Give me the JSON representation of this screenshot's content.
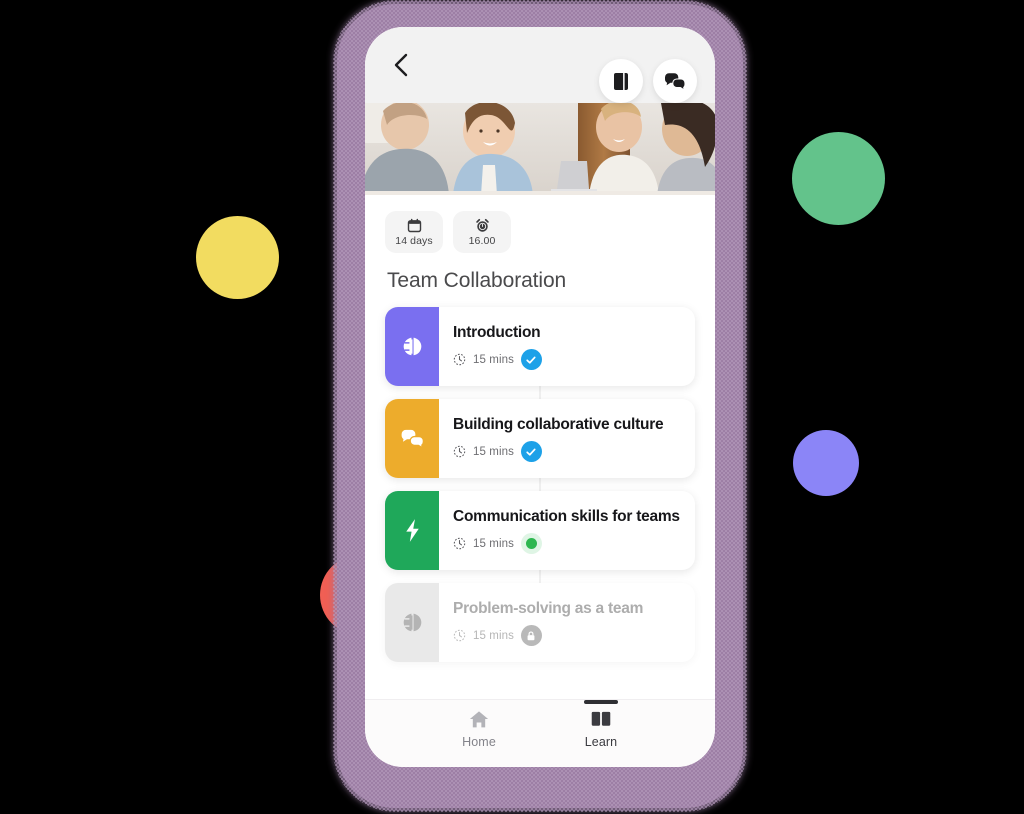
{
  "colors": {
    "deco_green": "#63c38b",
    "deco_yellow": "#f2dc60",
    "deco_purple": "#8b85f7",
    "deco_red": "#f05f54",
    "phone_frame": "#9d7fa5",
    "badge_check": "#1da1e8",
    "badge_dot": "#2eb750",
    "badge_lock": "#b9b9b9",
    "tile_intro": "#7a6ff0",
    "tile_culture": "#edac2c",
    "tile_communication": "#1fa85a",
    "tile_locked": "#e9e9e9"
  },
  "header": {
    "back_icon": "chevron-left-icon",
    "actions": [
      {
        "name": "book-button",
        "icon": "book-icon"
      },
      {
        "name": "chat-button",
        "icon": "chat-bubbles-icon"
      }
    ]
  },
  "hero": {
    "alt": "team collaborating at a table"
  },
  "chips": [
    {
      "icon": "calendar-icon",
      "label": "14 days"
    },
    {
      "icon": "alarm-clock-icon",
      "label": "16.00"
    }
  ],
  "main": {
    "title": "Team Collaboration",
    "lessons": [
      {
        "title": "Introduction",
        "duration": "15 mins",
        "duration_icon": "timer-icon",
        "tile_icon": "brain-icon",
        "tile_color": "#7a6ff0",
        "status": "completed",
        "status_icon": "check-icon",
        "locked": false
      },
      {
        "title": "Building collaborative culture",
        "duration": "15 mins",
        "duration_icon": "timer-icon",
        "tile_icon": "chat-bubbles-icon",
        "tile_color": "#edac2c",
        "status": "completed",
        "status_icon": "check-icon",
        "locked": false
      },
      {
        "title": "Communication skills for teams",
        "duration": "15 mins",
        "duration_icon": "timer-icon",
        "tile_icon": "lightning-bolt-icon",
        "tile_color": "#1fa85a",
        "status": "in-progress",
        "status_icon": "dot-icon",
        "locked": false
      },
      {
        "title": "Problem-solving as a team",
        "duration": "15 mins",
        "duration_icon": "timer-icon",
        "tile_icon": "brain-icon",
        "tile_color": "#e9e9e9",
        "status": "locked",
        "status_icon": "lock-icon",
        "locked": true
      }
    ]
  },
  "bottom_nav": {
    "items": [
      {
        "label": "Home",
        "icon": "home-icon",
        "active": false
      },
      {
        "label": "Learn",
        "icon": "open-book-icon",
        "active": true
      }
    ]
  }
}
